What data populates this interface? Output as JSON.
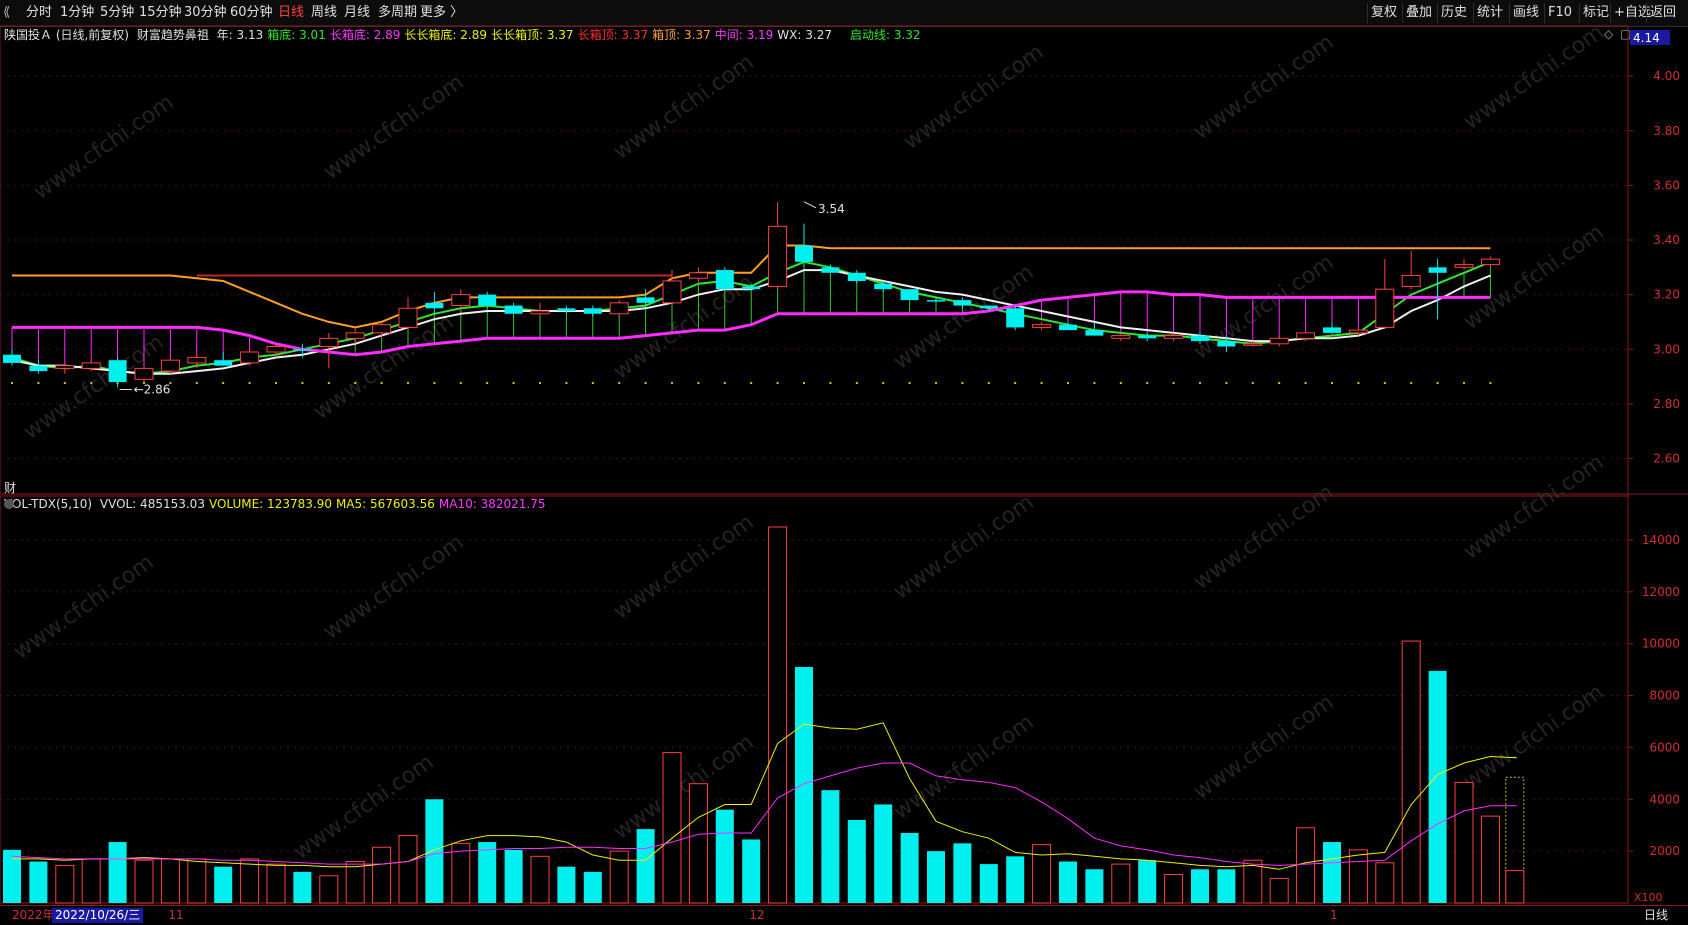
{
  "toolbar": {
    "left_icon": "⟪",
    "periods": [
      "分时",
      "1分钟",
      "5分钟",
      "15分钟",
      "30分钟",
      "60分钟",
      "日线",
      "周线",
      "月线",
      "多周期",
      "更多 〉"
    ],
    "active_period": "日线",
    "right_buttons": [
      "复权",
      "叠加",
      "历史",
      "统计",
      "画线",
      "F10",
      "标记",
      "+自选",
      "返回"
    ]
  },
  "indicator_line": {
    "title": "陕国投Ａ (日线,前复权)",
    "formula": "财富趋势鼻祖",
    "items": [
      {
        "text": "年: 3.13",
        "color": "#e0e0e0"
      },
      {
        "text": "箱底: 3.01",
        "color": "#2ee82e"
      },
      {
        "text": "长箱底: 2.89",
        "color": "#ff3cff"
      },
      {
        "text": "长长箱底: 2.89",
        "color": "#f0f000"
      },
      {
        "text": "长长箱顶: 3.37",
        "color": "#f0f000"
      },
      {
        "text": "长箱顶: 3.37",
        "color": "#ff3030"
      },
      {
        "text": "箱顶: 3.37",
        "color": "#ffa040"
      },
      {
        "text": "中间: 3.19",
        "color": "#ff3cff"
      },
      {
        "text": "WX: 3.27",
        "color": "#e0e0e0"
      },
      {
        "text": "启动线: 3.32",
        "color": "#2ee82e"
      }
    ],
    "right_icons": [
      "◇",
      "▢"
    ]
  },
  "vol_line": {
    "title": "VOL-TDX(5,10)",
    "items": [
      {
        "text": "VVOL: 485153.03",
        "color": "#e0e0e0"
      },
      {
        "text": "VOLUME: 123783.90",
        "color": "#f0f000"
      },
      {
        "text": "MA5: 567603.56",
        "color": "#f0f000"
      },
      {
        "text": "MA10: 382021.75",
        "color": "#ff3cff"
      }
    ]
  },
  "cai_label": "财",
  "watermark": "www.cfchi.com",
  "chart_data": [
    {
      "type": "candlestick",
      "ylim": [
        2.47,
        4.18
      ],
      "y_ticks": [
        "4.00",
        "3.80",
        "3.60",
        "3.40",
        "3.20",
        "3.00",
        "2.80",
        "2.60"
      ],
      "y_tick_values": [
        4.0,
        3.8,
        3.6,
        3.4,
        3.2,
        3.0,
        2.8,
        2.6
      ],
      "price_tag": "4.14",
      "annotations": [
        {
          "text": "3.54",
          "index": 30,
          "value": 3.54
        },
        {
          "text": "2.86",
          "index": 4,
          "value": 2.86
        }
      ],
      "candles": [
        {
          "o": 2.98,
          "h": 3.0,
          "l": 2.94,
          "c": 2.95,
          "up": false
        },
        {
          "o": 2.94,
          "h": 2.96,
          "l": 2.91,
          "c": 2.92,
          "up": false
        },
        {
          "o": 2.93,
          "h": 2.95,
          "l": 2.91,
          "c": 2.94,
          "up": true
        },
        {
          "o": 2.93,
          "h": 2.96,
          "l": 2.92,
          "c": 2.95,
          "up": true
        },
        {
          "o": 2.96,
          "h": 2.97,
          "l": 2.86,
          "c": 2.88,
          "up": false
        },
        {
          "o": 2.89,
          "h": 2.94,
          "l": 2.88,
          "c": 2.93,
          "up": true
        },
        {
          "o": 2.92,
          "h": 2.97,
          "l": 2.91,
          "c": 2.96,
          "up": true
        },
        {
          "o": 2.95,
          "h": 2.98,
          "l": 2.93,
          "c": 2.97,
          "up": true
        },
        {
          "o": 2.96,
          "h": 2.99,
          "l": 2.94,
          "c": 2.94,
          "up": false
        },
        {
          "o": 2.95,
          "h": 3.0,
          "l": 2.94,
          "c": 2.99,
          "up": true
        },
        {
          "o": 2.99,
          "h": 3.02,
          "l": 2.97,
          "c": 3.01,
          "up": true
        },
        {
          "o": 3.0,
          "h": 3.02,
          "l": 2.97,
          "c": 3.0,
          "up": false
        },
        {
          "o": 3.01,
          "h": 3.06,
          "l": 2.93,
          "c": 3.04,
          "up": true
        },
        {
          "o": 3.04,
          "h": 3.08,
          "l": 3.02,
          "c": 3.06,
          "up": true
        },
        {
          "o": 3.06,
          "h": 3.1,
          "l": 3.04,
          "c": 3.09,
          "up": true
        },
        {
          "o": 3.08,
          "h": 3.19,
          "l": 3.07,
          "c": 3.15,
          "up": true
        },
        {
          "o": 3.15,
          "h": 3.21,
          "l": 3.13,
          "c": 3.17,
          "up": false
        },
        {
          "o": 3.16,
          "h": 3.22,
          "l": 3.14,
          "c": 3.2,
          "up": true
        },
        {
          "o": 3.2,
          "h": 3.21,
          "l": 3.15,
          "c": 3.16,
          "up": false
        },
        {
          "o": 3.16,
          "h": 3.17,
          "l": 3.13,
          "c": 3.13,
          "up": false
        },
        {
          "o": 3.13,
          "h": 3.17,
          "l": 3.12,
          "c": 3.14,
          "up": true
        },
        {
          "o": 3.15,
          "h": 3.16,
          "l": 3.13,
          "c": 3.14,
          "up": false
        },
        {
          "o": 3.15,
          "h": 3.16,
          "l": 3.12,
          "c": 3.13,
          "up": false
        },
        {
          "o": 3.13,
          "h": 3.18,
          "l": 3.12,
          "c": 3.17,
          "up": true
        },
        {
          "o": 3.17,
          "h": 3.22,
          "l": 3.16,
          "c": 3.19,
          "up": false
        },
        {
          "o": 3.17,
          "h": 3.29,
          "l": 3.16,
          "c": 3.25,
          "up": true
        },
        {
          "o": 3.26,
          "h": 3.3,
          "l": 3.24,
          "c": 3.28,
          "up": true
        },
        {
          "o": 3.29,
          "h": 3.3,
          "l": 3.22,
          "c": 3.22,
          "up": false
        },
        {
          "o": 3.22,
          "h": 3.24,
          "l": 3.22,
          "c": 3.23,
          "up": false
        },
        {
          "o": 3.23,
          "h": 3.54,
          "l": 3.22,
          "c": 3.45,
          "up": true
        },
        {
          "o": 3.38,
          "h": 3.46,
          "l": 3.3,
          "c": 3.32,
          "up": false
        },
        {
          "o": 3.3,
          "h": 3.31,
          "l": 3.28,
          "c": 3.28,
          "up": false
        },
        {
          "o": 3.28,
          "h": 3.29,
          "l": 3.24,
          "c": 3.25,
          "up": false
        },
        {
          "o": 3.24,
          "h": 3.25,
          "l": 3.21,
          "c": 3.22,
          "up": false
        },
        {
          "o": 3.22,
          "h": 3.22,
          "l": 3.18,
          "c": 3.18,
          "up": false
        },
        {
          "o": 3.18,
          "h": 3.19,
          "l": 3.17,
          "c": 3.18,
          "up": false
        },
        {
          "o": 3.18,
          "h": 3.19,
          "l": 3.15,
          "c": 3.16,
          "up": false
        },
        {
          "o": 3.16,
          "h": 3.16,
          "l": 3.14,
          "c": 3.15,
          "up": false
        },
        {
          "o": 3.15,
          "h": 3.16,
          "l": 3.07,
          "c": 3.08,
          "up": false
        },
        {
          "o": 3.08,
          "h": 3.1,
          "l": 3.07,
          "c": 3.09,
          "up": true
        },
        {
          "o": 3.09,
          "h": 3.1,
          "l": 3.07,
          "c": 3.07,
          "up": false
        },
        {
          "o": 3.07,
          "h": 3.1,
          "l": 3.05,
          "c": 3.05,
          "up": false
        },
        {
          "o": 3.05,
          "h": 3.06,
          "l": 3.03,
          "c": 3.04,
          "up": true
        },
        {
          "o": 3.05,
          "h": 3.06,
          "l": 3.03,
          "c": 3.04,
          "up": false
        },
        {
          "o": 3.04,
          "h": 3.06,
          "l": 3.03,
          "c": 3.05,
          "up": true
        },
        {
          "o": 3.05,
          "h": 3.06,
          "l": 3.02,
          "c": 3.03,
          "up": false
        },
        {
          "o": 3.03,
          "h": 3.05,
          "l": 2.99,
          "c": 3.01,
          "up": false
        },
        {
          "o": 3.02,
          "h": 3.03,
          "l": 3.01,
          "c": 3.02,
          "up": true
        },
        {
          "o": 3.02,
          "h": 3.05,
          "l": 3.01,
          "c": 3.04,
          "up": true
        },
        {
          "o": 3.04,
          "h": 3.07,
          "l": 3.03,
          "c": 3.06,
          "up": true
        },
        {
          "o": 3.08,
          "h": 3.1,
          "l": 3.06,
          "c": 3.06,
          "up": false
        },
        {
          "o": 3.06,
          "h": 3.08,
          "l": 3.05,
          "c": 3.07,
          "up": true
        },
        {
          "o": 3.08,
          "h": 3.33,
          "l": 3.08,
          "c": 3.22,
          "up": true
        },
        {
          "o": 3.23,
          "h": 3.36,
          "l": 3.22,
          "c": 3.27,
          "up": true
        },
        {
          "o": 3.3,
          "h": 3.33,
          "l": 3.11,
          "c": 3.28,
          "up": false
        },
        {
          "o": 3.3,
          "h": 3.33,
          "l": 3.29,
          "c": 3.31,
          "up": true
        },
        {
          "o": 3.31,
          "h": 3.34,
          "l": 3.3,
          "c": 3.33,
          "up": true
        }
      ],
      "lines": [
        {
          "name": "箱底",
          "color": "#2ee82e",
          "values": [
            2.97,
            2.94,
            2.93,
            2.94,
            2.92,
            2.91,
            2.92,
            2.94,
            2.95,
            2.97,
            2.98,
            3.0,
            3.02,
            3.04,
            3.07,
            3.1,
            3.13,
            3.15,
            3.16,
            3.15,
            3.14,
            3.14,
            3.14,
            3.15,
            3.16,
            3.2,
            3.24,
            3.25,
            3.23,
            3.28,
            3.32,
            3.3,
            3.27,
            3.24,
            3.21,
            3.19,
            3.17,
            3.15,
            3.13,
            3.11,
            3.09,
            3.07,
            3.06,
            3.05,
            3.05,
            3.04,
            3.03,
            3.02,
            3.03,
            3.04,
            3.05,
            3.06,
            3.13,
            3.2,
            3.24,
            3.28,
            3.32
          ]
        },
        {
          "name": "WX",
          "color": "#f0f0f0",
          "values": [
            2.96,
            2.94,
            2.94,
            2.93,
            2.92,
            2.91,
            2.91,
            2.92,
            2.93,
            2.95,
            2.97,
            2.98,
            3.0,
            3.02,
            3.05,
            3.08,
            3.11,
            3.13,
            3.14,
            3.14,
            3.14,
            3.14,
            3.14,
            3.14,
            3.15,
            3.17,
            3.2,
            3.22,
            3.22,
            3.25,
            3.29,
            3.29,
            3.27,
            3.25,
            3.23,
            3.21,
            3.2,
            3.18,
            3.16,
            3.14,
            3.12,
            3.1,
            3.08,
            3.07,
            3.06,
            3.05,
            3.04,
            3.03,
            3.03,
            3.04,
            3.04,
            3.05,
            3.08,
            3.14,
            3.18,
            3.23,
            3.27
          ]
        },
        {
          "name": "箱顶",
          "color": "#ffa020",
          "values": [
            3.27,
            3.27,
            3.27,
            3.27,
            3.27,
            3.27,
            3.27,
            3.26,
            3.25,
            3.21,
            3.17,
            3.13,
            3.1,
            3.08,
            3.1,
            3.14,
            3.17,
            3.19,
            3.19,
            3.19,
            3.19,
            3.19,
            3.19,
            3.19,
            3.2,
            3.26,
            3.28,
            3.28,
            3.28,
            3.38,
            3.38,
            3.37,
            3.37,
            3.37,
            3.37,
            3.37,
            3.37,
            3.37,
            3.37,
            3.37,
            3.37,
            3.37,
            3.37,
            3.37,
            3.37,
            3.37,
            3.37,
            3.37,
            3.37,
            3.37,
            3.37,
            3.37,
            3.37,
            3.37,
            3.37,
            3.37,
            3.37
          ]
        },
        {
          "name": "长箱顶",
          "color": "#c02828",
          "values": [
            null,
            null,
            null,
            null,
            null,
            null,
            null,
            3.27,
            3.27,
            3.27,
            3.27,
            3.27,
            3.27,
            3.27,
            3.27,
            3.27,
            3.27,
            3.27,
            3.27,
            3.27,
            3.27,
            3.27,
            3.27,
            3.27,
            3.27,
            3.27,
            null,
            null,
            null,
            null,
            null,
            null,
            null,
            null,
            null,
            null,
            null,
            null,
            null,
            null,
            null,
            null,
            null,
            null,
            null,
            null,
            null,
            null,
            null,
            null,
            null,
            null,
            null,
            null,
            null,
            null,
            null
          ]
        },
        {
          "name": "中间",
          "color": "#ff2cff",
          "values": [
            3.08,
            3.08,
            3.08,
            3.08,
            3.08,
            3.08,
            3.08,
            3.08,
            3.07,
            3.05,
            3.02,
            3.0,
            2.99,
            2.98,
            2.99,
            3.01,
            3.02,
            3.03,
            3.04,
            3.04,
            3.04,
            3.04,
            3.04,
            3.04,
            3.05,
            3.06,
            3.07,
            3.07,
            3.09,
            3.13,
            3.13,
            3.13,
            3.13,
            3.13,
            3.13,
            3.13,
            3.13,
            3.14,
            3.16,
            3.18,
            3.19,
            3.2,
            3.21,
            3.21,
            3.2,
            3.2,
            3.19,
            3.19,
            3.19,
            3.19,
            3.19,
            3.19,
            3.19,
            3.19,
            3.19,
            3.19,
            3.19
          ]
        }
      ]
    },
    {
      "type": "bar",
      "unit": "X100",
      "ylim": [
        0,
        15000
      ],
      "y_ticks": [
        "14000",
        "12000",
        "10000",
        "8000",
        "6000",
        "4000",
        "2000"
      ],
      "y_tick_values": [
        14000,
        12000,
        10000,
        8000,
        6000,
        4000,
        2000
      ],
      "volumes": [
        2050,
        1600,
        1450,
        1700,
        2350,
        1650,
        1700,
        1700,
        1400,
        1700,
        1500,
        1200,
        1050,
        1600,
        2150,
        2600,
        4000,
        2300,
        2350,
        2050,
        1800,
        1400,
        1200,
        2000,
        2850,
        5800,
        4600,
        3600,
        2450,
        14500,
        9100,
        4350,
        3200,
        3800,
        2700,
        2000,
        2300,
        1500,
        1800,
        2250,
        1600,
        1300,
        1500,
        1650,
        1100,
        1300,
        1300,
        1650,
        950,
        2900,
        2350,
        2050,
        1550,
        10100,
        8950,
        4650,
        3350
      ],
      "ma5": [
        1700,
        1700,
        1650,
        1700,
        1700,
        1750,
        1700,
        1600,
        1550,
        1500,
        1450,
        1450,
        1400,
        1400,
        1500,
        1600,
        2050,
        2400,
        2600,
        2600,
        2550,
        2350,
        1850,
        1650,
        1650,
        2500,
        3300,
        3800,
        3800,
        6150,
        6900,
        6750,
        6700,
        6950,
        4800,
        3150,
        2750,
        2500,
        1950,
        1850,
        1900,
        1800,
        1700,
        1650,
        1550,
        1450,
        1400,
        1450,
        1300,
        1550,
        1700,
        1850,
        1950,
        3800,
        4950,
        5400,
        5650,
        5600
      ],
      "ma10": [
        1800,
        1750,
        1700,
        1700,
        1700,
        1700,
        1700,
        1700,
        1650,
        1650,
        1600,
        1550,
        1500,
        1500,
        1500,
        1600,
        1900,
        2000,
        2050,
        2100,
        2100,
        2150,
        2150,
        2100,
        2100,
        2350,
        2650,
        2700,
        2700,
        4050,
        4600,
        4900,
        5200,
        5400,
        5400,
        4900,
        4750,
        4650,
        4450,
        3900,
        3250,
        2500,
        2200,
        2050,
        1850,
        1750,
        1600,
        1500,
        1450,
        1500,
        1550,
        1600,
        1650,
        2400,
        3050,
        3550,
        3750,
        3750
      ]
    }
  ],
  "bottom": {
    "year_label": "2022年",
    "date_label": "2022/10/26/三",
    "month_labels": [
      {
        "text": "11",
        "index": 6
      },
      {
        "text": "12",
        "index": 28
      },
      {
        "text": "1",
        "index": 50
      }
    ],
    "period_label": "日线"
  }
}
